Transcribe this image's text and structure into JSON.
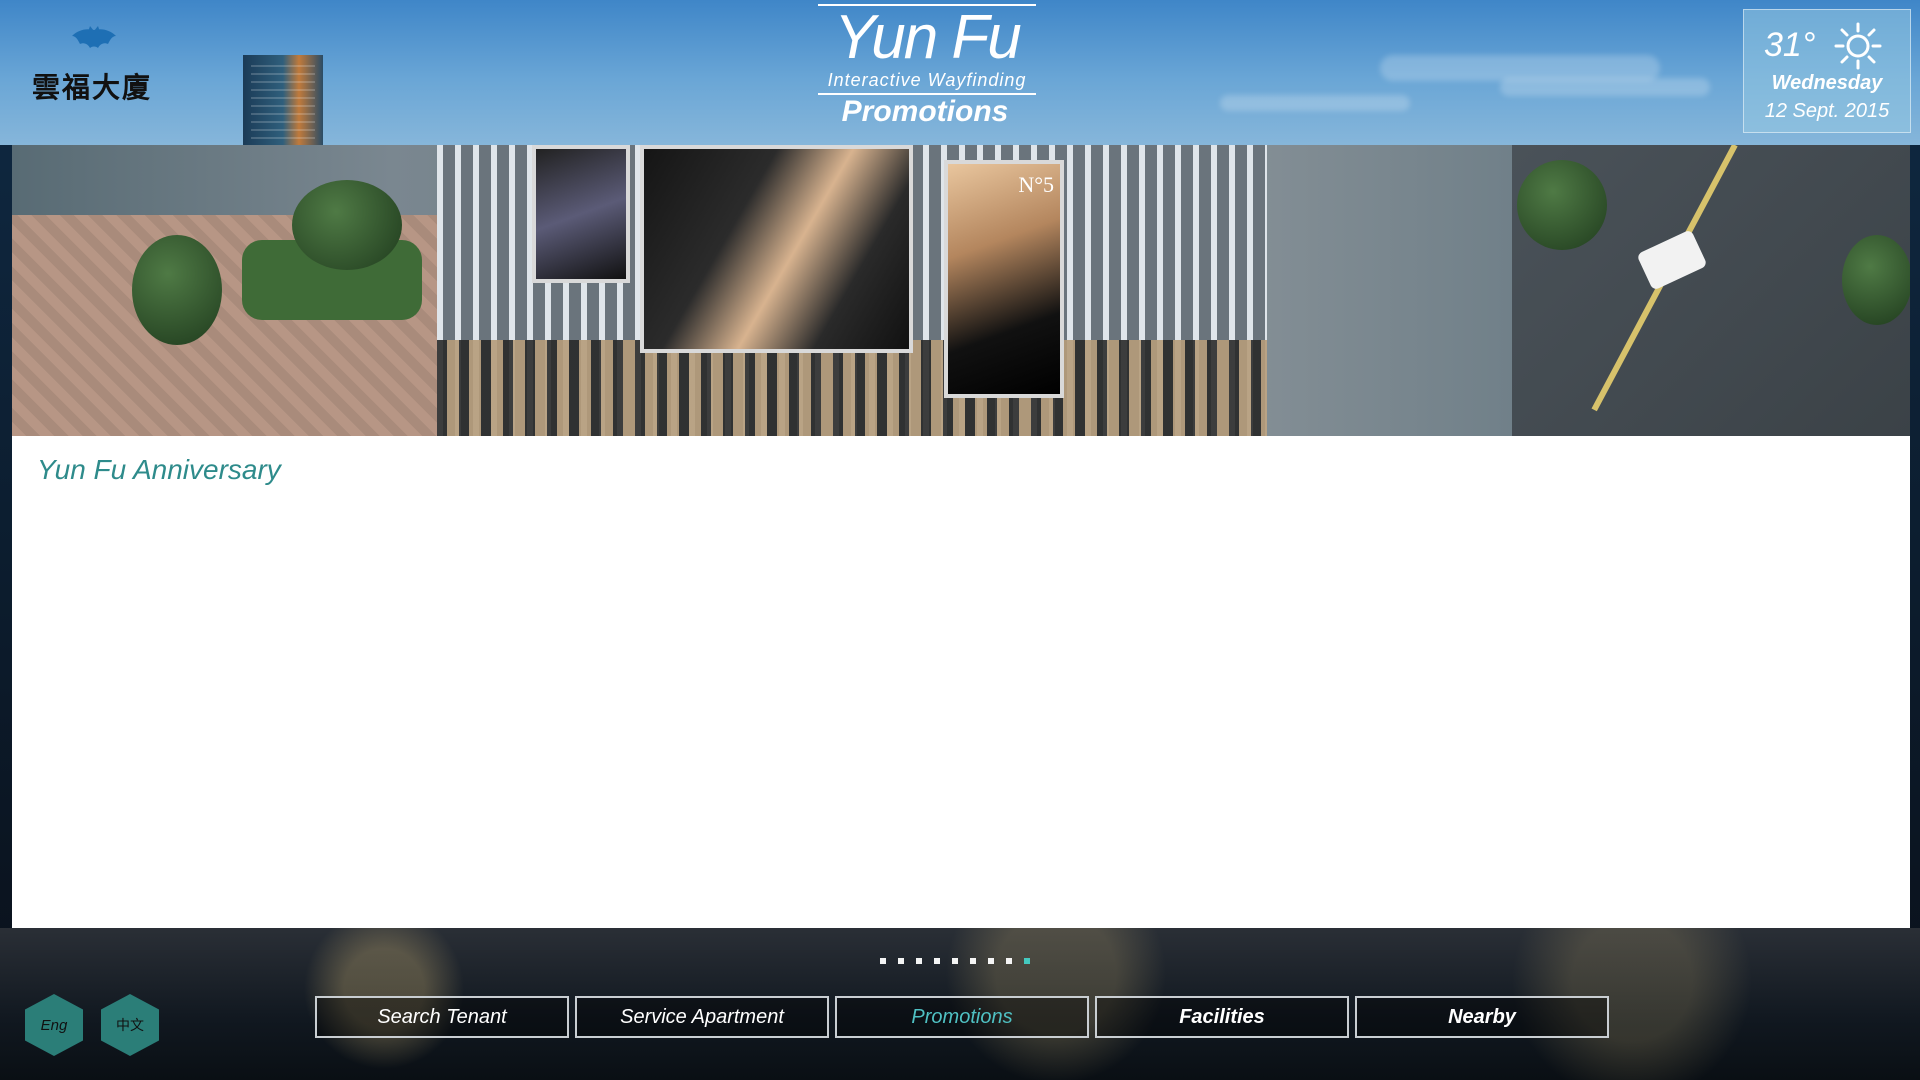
{
  "header": {
    "logo_text": "雲福大廈",
    "brand_title": "Yun Fu",
    "brand_subtitle": "Interactive Wayfinding",
    "page_title": "Promotions"
  },
  "weather": {
    "temperature": "31°",
    "day": "Wednesday",
    "date": "12 Sept. 2015",
    "icon": "sun-icon"
  },
  "banner": {
    "billboard_text": "N°5"
  },
  "content": {
    "promotion_title": "Yun Fu Anniversary"
  },
  "pagination": {
    "total": 9,
    "active_index": 9
  },
  "language": {
    "english_label": "Eng",
    "chinese_label": "中文"
  },
  "nav": {
    "items": [
      {
        "label": "Search Tenant"
      },
      {
        "label": "Service Apartment"
      },
      {
        "label": "Promotions"
      },
      {
        "label": "Facilities"
      },
      {
        "label": "Nearby"
      }
    ],
    "active_label": "Promotions"
  },
  "colors": {
    "accent": "#2e8b8b",
    "active_nav": "#4fc1c3",
    "lang_button": "#2b7e78"
  }
}
